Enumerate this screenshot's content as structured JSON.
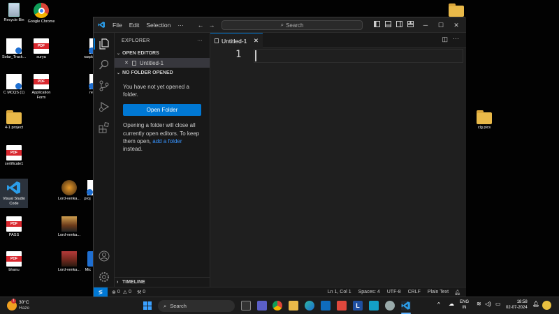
{
  "desktop": {
    "icons": [
      {
        "name": "recycle-bin",
        "label": "Recycle Bin"
      },
      {
        "name": "google-chrome",
        "label": "Google Chrome"
      },
      {
        "name": "solar-track",
        "label": "Solar_Track..."
      },
      {
        "name": "surya",
        "label": "surya"
      },
      {
        "name": "raspb",
        "label": "raspb"
      },
      {
        "name": "c-mcqs",
        "label": "C MCQS (1)"
      },
      {
        "name": "application-form",
        "label": "Application Form"
      },
      {
        "name": "re",
        "label": "re"
      },
      {
        "name": "4-1-project",
        "label": "4-1 project"
      },
      {
        "name": "certificate1",
        "label": "certificate1"
      },
      {
        "name": "visual-studio-code",
        "label": "Visual Studio Code"
      },
      {
        "name": "lord-venka-1",
        "label": "Lord-venka..."
      },
      {
        "name": "proj",
        "label": "proj"
      },
      {
        "name": "pass",
        "label": "PASS"
      },
      {
        "name": "lord-venka-2",
        "label": "Lord-venka..."
      },
      {
        "name": "bhanu",
        "label": "bhanu"
      },
      {
        "name": "lord-venka-3",
        "label": "Lord-venka..."
      },
      {
        "name": "mic",
        "label": "Mic"
      },
      {
        "name": "clg-pics",
        "label": "clg pics"
      }
    ]
  },
  "vscode": {
    "menu": [
      "File",
      "Edit",
      "Selection",
      "···"
    ],
    "search_label": "Search",
    "explorer_title": "EXPLORER",
    "explorer_more": "···",
    "open_editors_header": "OPEN EDITORS",
    "open_editor_item": "Untitled-1",
    "no_folder_header": "NO FOLDER OPENED",
    "no_folder_msg": "You have not yet opened a folder.",
    "open_folder_button": "Open Folder",
    "info_text_1": "Opening a folder will close all currently open editors. To keep them open,",
    "info_link": "add a folder",
    "info_text_2": "instead.",
    "timeline_header": "TIMELINE",
    "tab_label": "Untitled-1",
    "line_number": "1",
    "status": {
      "errors": "0",
      "warnings": "0",
      "ports": "0",
      "position": "Ln 1, Col 1",
      "spaces": "Spaces: 4",
      "encoding": "UTF-8",
      "eol": "CRLF",
      "language": "Plain Text"
    }
  },
  "taskbar": {
    "weather_temp": "30°C",
    "weather_desc": "Haze",
    "weather_badge": "1",
    "search_placeholder": "Search",
    "lang_top": "ENG",
    "lang_bottom": "IN",
    "time": "18:58",
    "date": "02-07-2024"
  },
  "colors": {
    "accent": "#0078d4",
    "pdf_red": "#d9282f",
    "folder": "#e9b949"
  }
}
